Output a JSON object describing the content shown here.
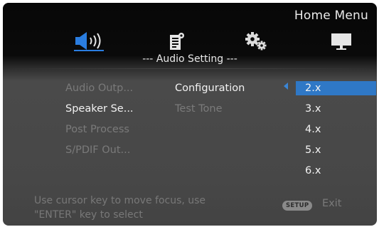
{
  "header": {
    "title": "Home Menu"
  },
  "tabs": [
    {
      "icon": "speaker-icon",
      "active": true
    },
    {
      "icon": "document-icon",
      "active": false
    },
    {
      "icon": "gear-icon",
      "active": false
    },
    {
      "icon": "monitor-icon",
      "active": false
    }
  ],
  "section": {
    "title": "--- Audio Setting ---"
  },
  "menu": {
    "items": [
      {
        "label": "Audio Outp...",
        "state": "dim"
      },
      {
        "label": "Speaker Se...",
        "state": "active"
      },
      {
        "label": "Post Process",
        "state": "dim"
      },
      {
        "label": "S/PDIF Out...",
        "state": "dim"
      }
    ]
  },
  "submenu": {
    "items": [
      {
        "label": "Configuration",
        "state": "active"
      },
      {
        "label": "Test Tone",
        "state": "dim"
      }
    ]
  },
  "options": {
    "items": [
      "2.x",
      "3.x",
      "4.x",
      "5.x",
      "6.x"
    ],
    "selected": "2.x"
  },
  "footer": {
    "help_line1": "Use cursor key to move focus, use",
    "help_line2": "\"ENTER\" key to select",
    "setup_badge": "SETUP",
    "exit_label": "Exit"
  },
  "colors": {
    "accent": "#2f78c6",
    "speaker_icon": "#2a7de0",
    "text_bright": "#f2f2f2",
    "text_dim": "#7a7a7a"
  }
}
